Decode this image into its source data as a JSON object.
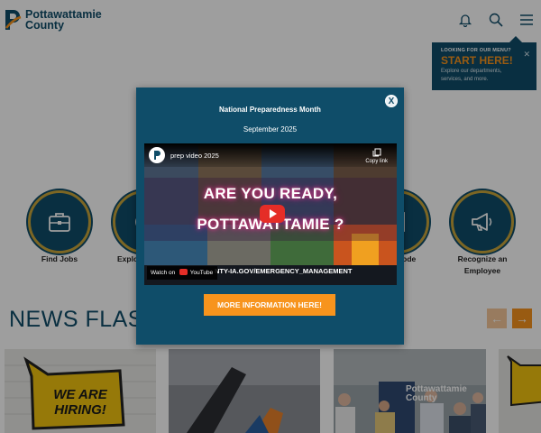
{
  "header": {
    "logo_line1": "Pottawattamie",
    "logo_line2": "County",
    "icons": [
      "bell-icon",
      "search-icon",
      "hamburger-menu-icon"
    ]
  },
  "menu_callout": {
    "small": "LOOKING FOR OUR MENU?",
    "big": "START HERE!",
    "desc": "Explore our departments, services, and more."
  },
  "quick_links": [
    {
      "label": "Find Jobs",
      "icon": "briefcase-icon"
    },
    {
      "label": "Explo",
      "icon": "explore-icon"
    },
    {
      "label": "Code",
      "icon": "document-icon"
    },
    {
      "label": "Recognize an Employee",
      "label_line1": "Recognize an",
      "label_line2": "Employee",
      "icon": "megaphone-icon"
    }
  ],
  "news": {
    "title": "NEWS FLAS",
    "cards": [
      {
        "sign_line1": "WE ARE",
        "sign_line2": "HIRING!"
      },
      {},
      {
        "banner_line1": "Pottawattamie",
        "banner_line2": "County"
      },
      {}
    ]
  },
  "modal": {
    "title": "National Preparedness Month",
    "subtitle": "September 2025",
    "video": {
      "title": "prep video 2025",
      "copy_link": "Copy link",
      "headline1": "ARE YOU READY,",
      "headline2": "POTTAWATTAMIE ?",
      "url_text": "NTY-IA.GOV/EMERGENCY_MANAGEMENT",
      "watch_on": "Watch on",
      "youtube": "YouTube"
    },
    "more_button": "MORE INFORMATION HERE!",
    "close": "X"
  },
  "colors": {
    "brand_blue": "#0f4d69",
    "accent_orange": "#f7941d",
    "circle_ring": "#c8a53a"
  }
}
